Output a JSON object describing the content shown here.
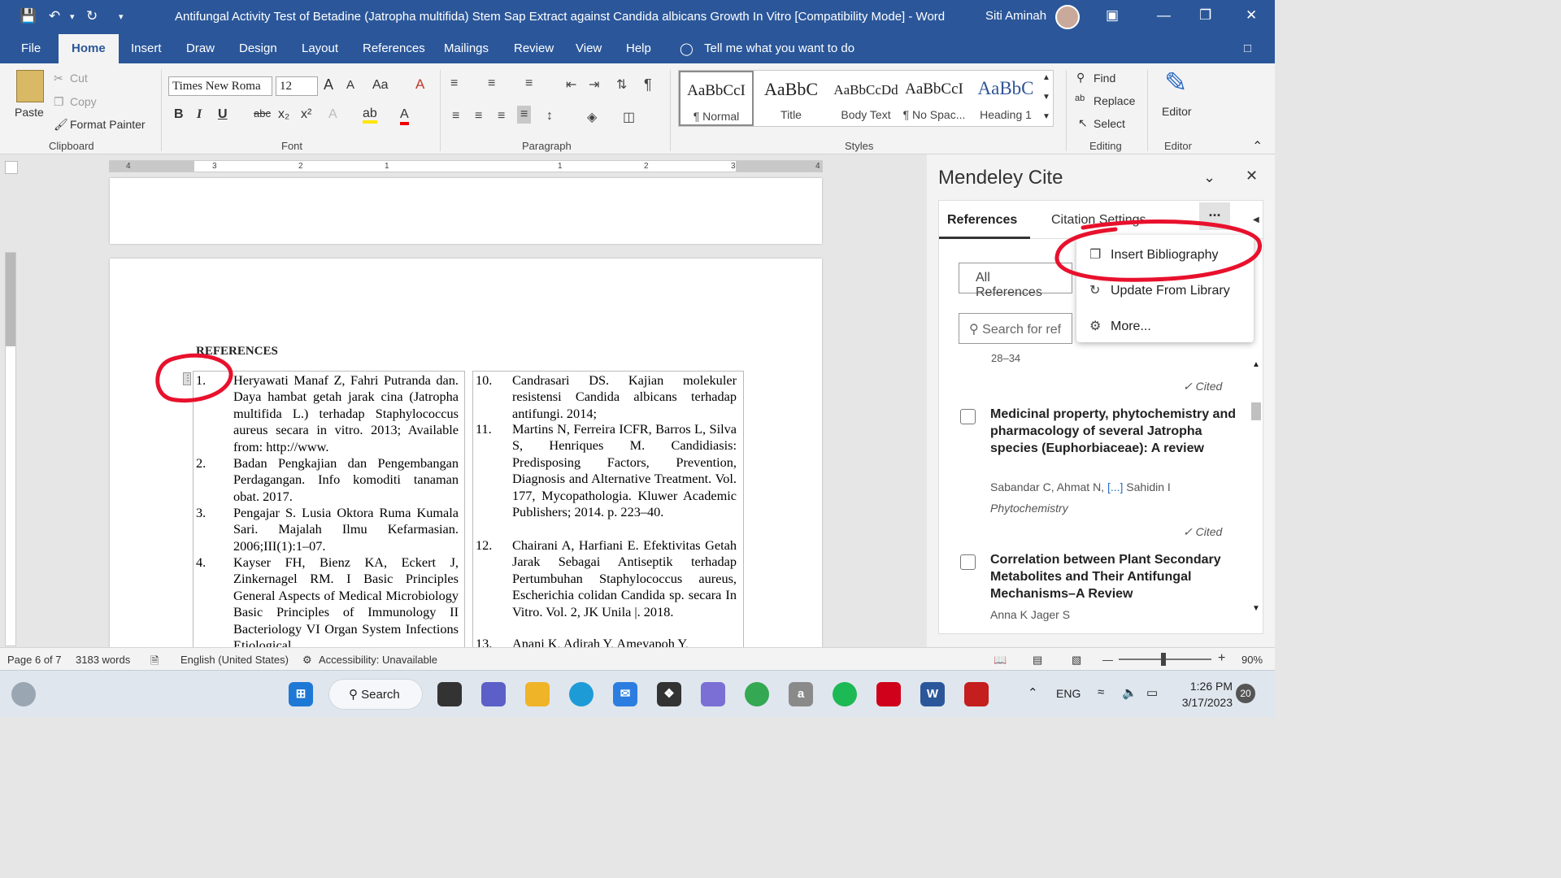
{
  "titlebar": {
    "title": "Antifungal Activity Test of Betadine (Jatropha multifida) Stem Sap Extract against Candida albicans Growth In Vitro [Compatibility Mode]  -  Word",
    "user": "Siti Aminah"
  },
  "menu": {
    "file": "File",
    "home": "Home",
    "insert": "Insert",
    "draw": "Draw",
    "design": "Design",
    "layout": "Layout",
    "references": "References",
    "mailings": "Mailings",
    "review": "Review",
    "view": "View",
    "help": "Help",
    "tell": "Tell me what you want to do"
  },
  "clipboard": {
    "paste": "Paste",
    "cut": "Cut",
    "copy": "Copy",
    "format_painter": "Format Painter",
    "label": "Clipboard"
  },
  "font": {
    "name": "Times New Roma",
    "size": "12",
    "label": "Font"
  },
  "paragraph": {
    "label": "Paragraph"
  },
  "styles": {
    "label": "Styles",
    "items": [
      {
        "preview": "AaBbCcI",
        "name": "¶ Normal"
      },
      {
        "preview": "AaBbC",
        "name": "Title"
      },
      {
        "preview": "AaBbCcDd",
        "name": "Body Text"
      },
      {
        "preview": "AaBbCcI",
        "name": "¶ No Spac..."
      },
      {
        "preview": "AaBbC",
        "name": "Heading 1"
      }
    ]
  },
  "editing": {
    "find": "Find",
    "replace": "Replace",
    "select": "Select",
    "label": "Editing"
  },
  "editor": {
    "label": "Editor",
    "group": "Editor"
  },
  "ruler": {
    "ticks": [
      "4",
      "3",
      "2",
      "1",
      "1",
      "2",
      "3",
      "4"
    ]
  },
  "document": {
    "heading": "REFERENCES",
    "left": [
      {
        "num": "1.",
        "text": "Heryawati Manaf Z, Fahri Putranda dan. Daya hambat getah jarak cina (Jatropha multifida L.) terhadap Staphylococcus aureus secara in vitro. 2013; Available from: http://www."
      },
      {
        "num": "2.",
        "text": "Badan Pengkajian dan Pengembangan Perdagangan. Info komoditi tanaman obat. 2017."
      },
      {
        "num": "3.",
        "text": "Pengajar S. Lusia Oktora Ruma Kumala Sari. Majalah Ilmu Kefarmasian. 2006;III(1):1–07."
      },
      {
        "num": "4.",
        "text": "Kayser FH, Bienz KA, Eckert J, Zinkernagel RM. I Basic Principles General Aspects of Medical Microbiology Basic Principles of Immunology II Bacteriology VI Organ System Infections Etiological"
      }
    ],
    "right": [
      {
        "num": "10.",
        "text": "Candrasari DS. Kajian molekuler resistensi Candida albicans terhadap antifungi. 2014;"
      },
      {
        "num": "11.",
        "text": "Martins N, Ferreira ICFR, Barros L, Silva S, Henriques M. Candidiasis: Predisposing Factors, Prevention, Diagnosis and Alternative Treatment. Vol. 177, Mycopathologia. Kluwer Academic Publishers; 2014. p. 223–40."
      },
      {
        "num": "12.",
        "text": "Chairani A, Harfiani E. Efektivitas Getah Jarak Sebagai Antiseptik terhadap Pertumbuhan Staphylococcus aureus, Escherichia colidan Candida sp. secara In Vitro. Vol. 2, JK Unila |. 2018."
      },
      {
        "num": "13.",
        "text": "Anani K, Adirah Y, Ameyapoh Y,"
      }
    ]
  },
  "mendeley": {
    "title": "Mendeley Cite",
    "tab_refs": "References",
    "tab_settings": "Citation Settings",
    "more": "...",
    "dropdown": "All References",
    "search_placeholder": "Search for ref",
    "partial": "28–34",
    "cited": "✓ Cited",
    "refs": [
      {
        "title": "Medicinal property, phytochemistry and pharmacology of several Jatropha species (Euphorbiaceae): A review",
        "authors_a": "Sabandar C, Ahmat N, ",
        "authors_link": "[...]",
        "authors_b": " Sahidin I",
        "journal": "Phytochemistry"
      },
      {
        "title": "Correlation between Plant Secondary Metabolites and Their Antifungal Mechanisms–A Review",
        "authors_a": "Anna K Jager S",
        "authors_link": "",
        "authors_b": "",
        "journal": ""
      }
    ],
    "menu": {
      "insert_bibliography": "Insert Bibliography",
      "update": "Update From Library",
      "more": "More..."
    }
  },
  "status": {
    "page": "Page 6 of 7",
    "words": "3183 words",
    "language": "English (United States)",
    "accessibility": "Accessibility: Unavailable",
    "zoom": "90%"
  },
  "taskbar": {
    "search": "Search",
    "lang": "ENG",
    "time": "1:26 PM",
    "date": "3/17/2023",
    "badge": "20"
  },
  "colors": {
    "word_blue": "#2b579a",
    "annotation_red": "#e8112d"
  }
}
